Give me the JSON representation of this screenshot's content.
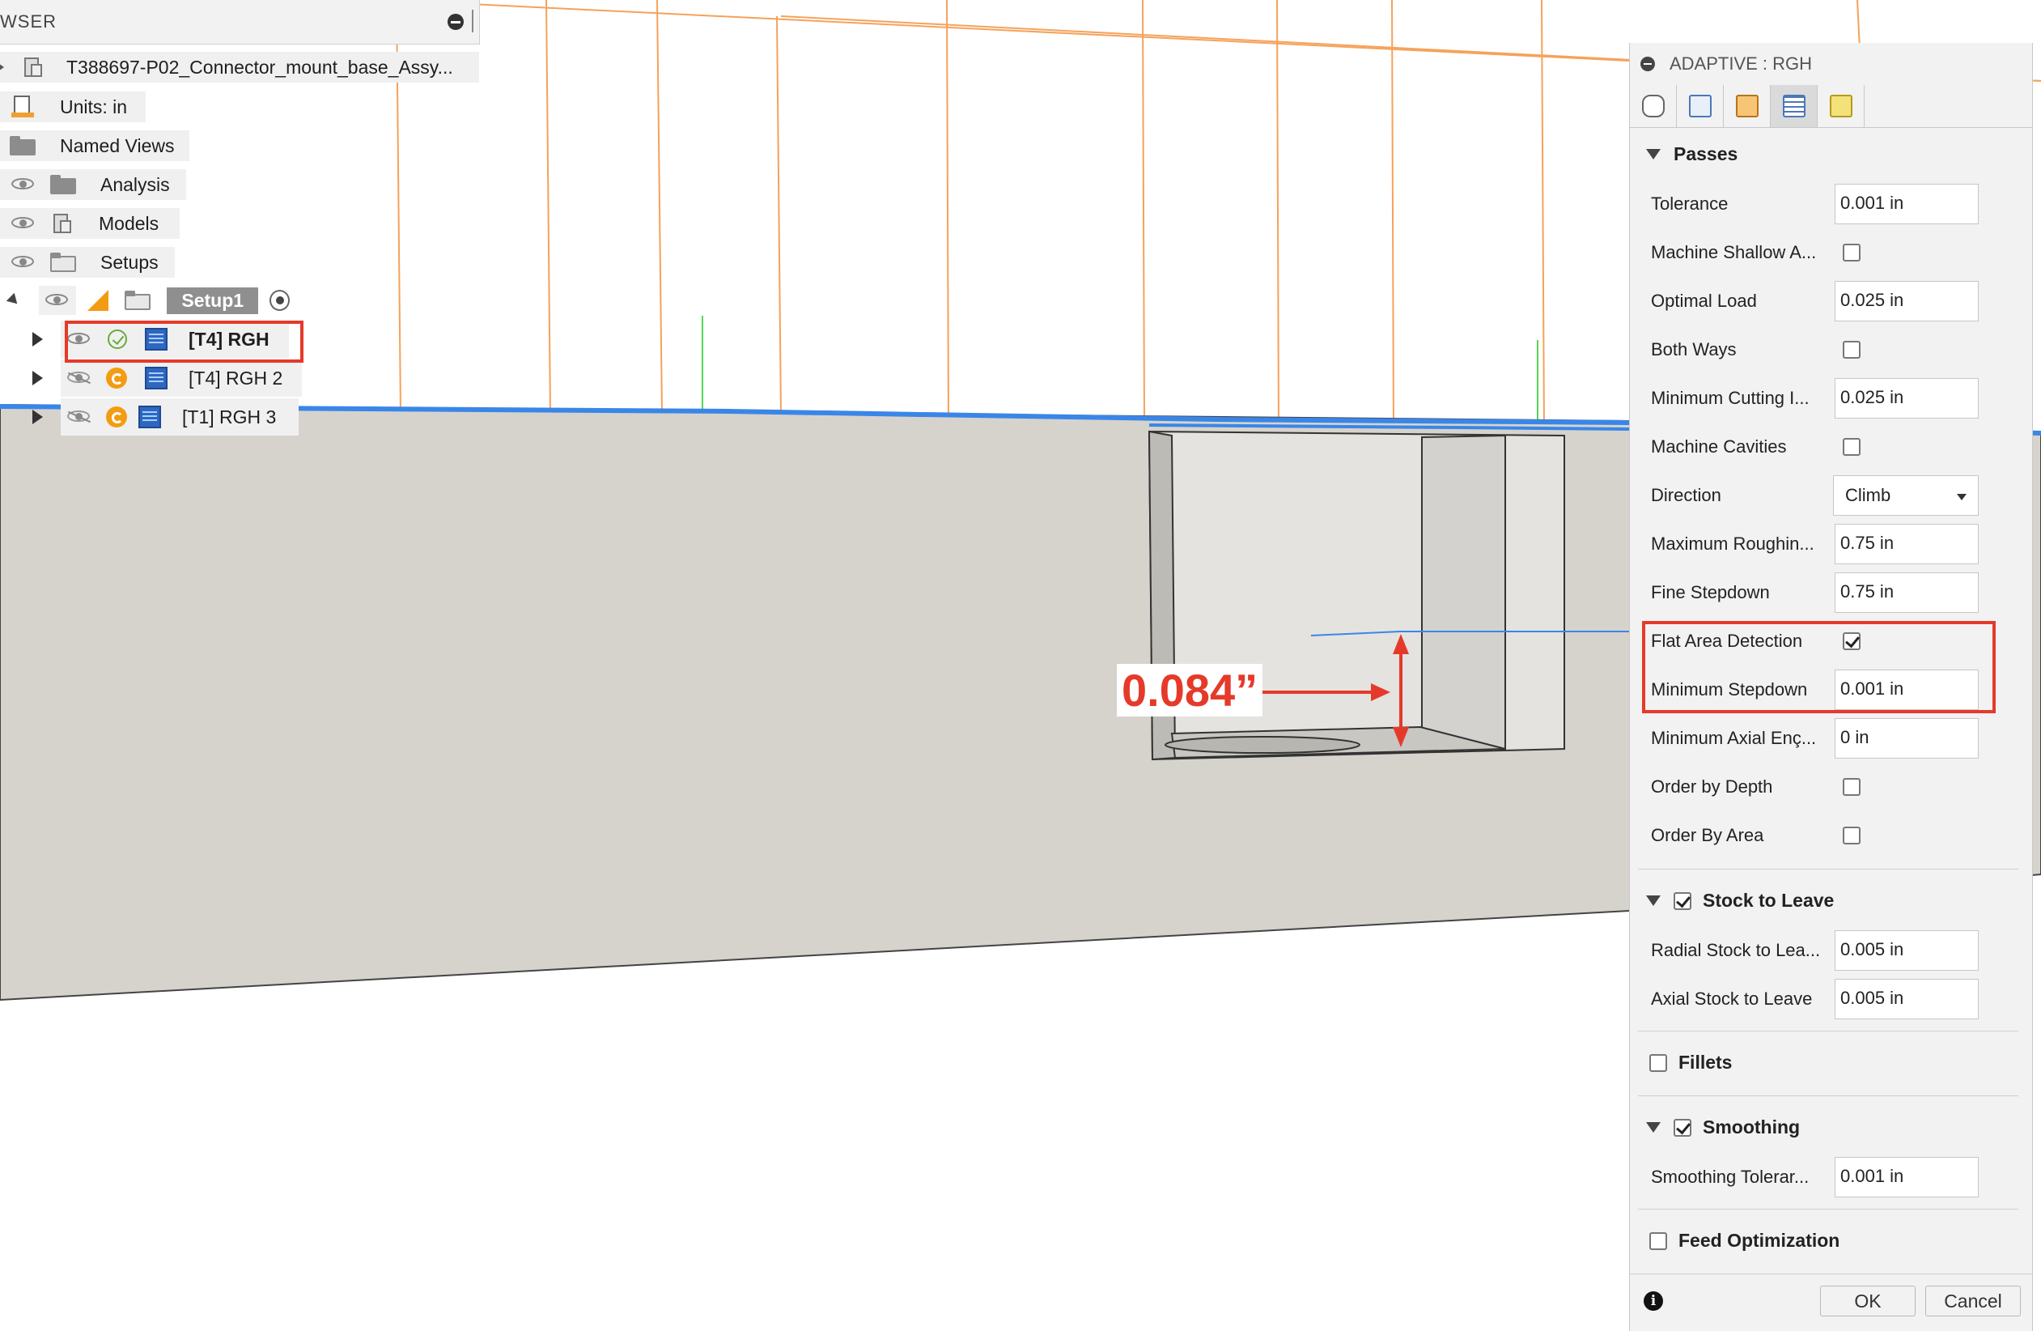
{
  "browser": {
    "title": "WSER",
    "root": "T388697-P02_Connector_mount_base_Assy...",
    "units": "Units: in",
    "named_views": "Named Views",
    "analysis": "Analysis",
    "models": "Models",
    "setups": "Setups",
    "setup1": "Setup1",
    "ops": [
      {
        "label": "[T4] RGH",
        "visible": true,
        "status": "ok"
      },
      {
        "label": "[T4] RGH 2",
        "visible": false,
        "status": "warning"
      },
      {
        "label": "[T1] RGH 3",
        "visible": false,
        "status": "warning"
      }
    ]
  },
  "annotation": {
    "text": "0.084”",
    "color": "#e53a2a"
  },
  "panel": {
    "title": "ADAPTIVE : RGH",
    "tabs": [
      "tool-tab",
      "geometry-tab",
      "heights-tab",
      "passes-tab",
      "linking-tab"
    ],
    "active_tab": "passes-tab",
    "passes": {
      "heading": "Passes",
      "tolerance": {
        "label": "Tolerance",
        "value": "0.001 in"
      },
      "machine_shallow": {
        "label": "Machine Shallow A...",
        "checked": false
      },
      "optimal_load": {
        "label": "Optimal Load",
        "value": "0.025 in"
      },
      "both_ways": {
        "label": "Both Ways",
        "checked": false
      },
      "min_cutting": {
        "label": "Minimum Cutting I...",
        "value": "0.025 in"
      },
      "machine_cavities": {
        "label": "Machine Cavities",
        "checked": false
      },
      "direction": {
        "label": "Direction",
        "value": "Climb"
      },
      "max_roughing": {
        "label": "Maximum Roughin...",
        "value": "0.75 in"
      },
      "fine_stepdown": {
        "label": "Fine Stepdown",
        "value": "0.75 in"
      },
      "flat_area": {
        "label": "Flat Area Detection",
        "checked": true
      },
      "min_stepdown": {
        "label": "Minimum Stepdown",
        "value": "0.001 in"
      },
      "min_axial": {
        "label": "Minimum Axial Enç...",
        "value": "0 in"
      },
      "order_depth": {
        "label": "Order by Depth",
        "checked": false
      },
      "order_area": {
        "label": "Order By Area",
        "checked": false
      }
    },
    "stock": {
      "heading": "Stock to Leave",
      "checked": true,
      "radial": {
        "label": "Radial Stock to Lea...",
        "value": "0.005 in"
      },
      "axial": {
        "label": "Axial Stock to Leave",
        "value": "0.005 in"
      }
    },
    "fillets": {
      "heading": "Fillets",
      "checked": false
    },
    "smoothing": {
      "heading": "Smoothing",
      "checked": true,
      "tolerance": {
        "label": "Smoothing Tolerar...",
        "value": "0.001 in"
      }
    },
    "feed_opt": {
      "heading": "Feed Optimization",
      "checked": false
    },
    "ok": "OK",
    "cancel": "Cancel"
  },
  "colors": {
    "highlight": "#e53a2a",
    "toolpath_blue": "#3a86e8",
    "stock_orange": "#f5a25a",
    "model_gray": "#d6d3cd"
  }
}
